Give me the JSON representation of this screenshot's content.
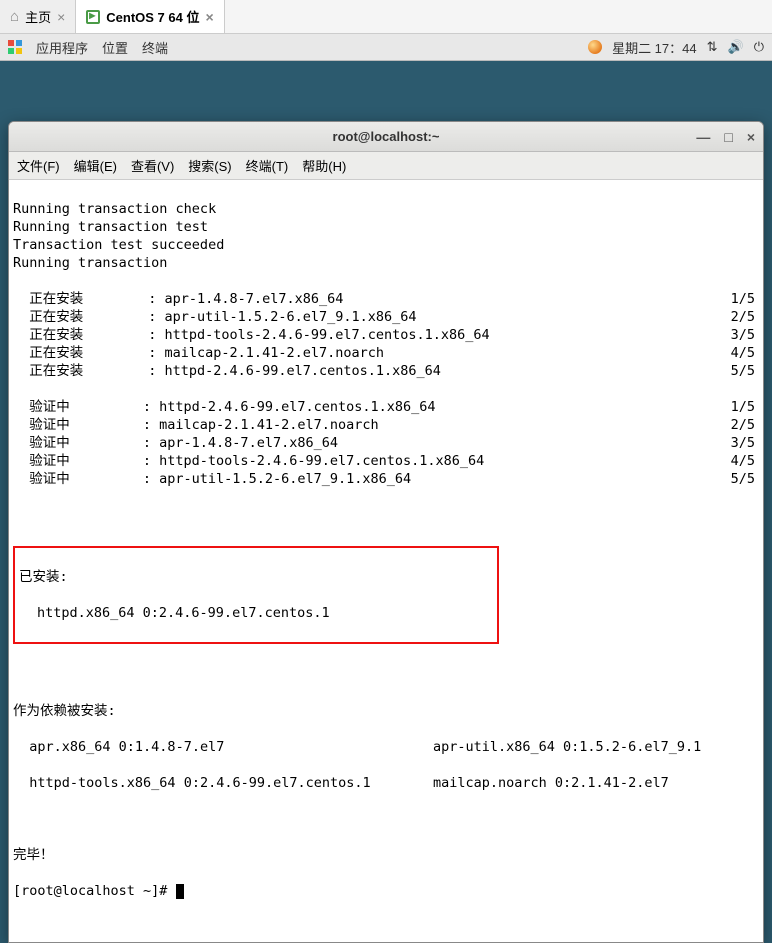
{
  "vmtabs": {
    "home": "主页",
    "centos": "CentOS 7 64 位"
  },
  "topbar": {
    "apps": "应用程序",
    "places": "位置",
    "terminal": "终端",
    "datetime": "星期二 17：44"
  },
  "window": {
    "title": "root@localhost:~"
  },
  "menubar": {
    "file": "文件(F)",
    "edit": "编辑(E)",
    "view": "查看(V)",
    "search": "搜索(S)",
    "terminal": "终端(T)",
    "help": "帮助(H)"
  },
  "output": {
    "pre": [
      "Running transaction check",
      "Running transaction test",
      "Transaction test succeeded",
      "Running transaction"
    ],
    "installing_label": "正在安装",
    "verifying_label": "验证中",
    "install_rows": [
      {
        "pkg": "apr-1.4.8-7.el7.x86_64",
        "n": "1/5"
      },
      {
        "pkg": "apr-util-1.5.2-6.el7_9.1.x86_64",
        "n": "2/5"
      },
      {
        "pkg": "httpd-tools-2.4.6-99.el7.centos.1.x86_64",
        "n": "3/5"
      },
      {
        "pkg": "mailcap-2.1.41-2.el7.noarch",
        "n": "4/5"
      },
      {
        "pkg": "httpd-2.4.6-99.el7.centos.1.x86_64",
        "n": "5/5"
      }
    ],
    "verify_rows": [
      {
        "pkg": "httpd-2.4.6-99.el7.centos.1.x86_64",
        "n": "1/5"
      },
      {
        "pkg": "mailcap-2.1.41-2.el7.noarch",
        "n": "2/5"
      },
      {
        "pkg": "apr-1.4.8-7.el7.x86_64",
        "n": "3/5"
      },
      {
        "pkg": "httpd-tools-2.4.6-99.el7.centos.1.x86_64",
        "n": "4/5"
      },
      {
        "pkg": "apr-util-1.5.2-6.el7_9.1.x86_64",
        "n": "5/5"
      }
    ],
    "installed_header": "已安装:",
    "installed_pkg": "httpd.x86_64 0:2.4.6-99.el7.centos.1",
    "deps_header": "作为依赖被安装:",
    "deps_line1_a": "apr.x86_64 0:1.4.8-7.el7",
    "deps_line1_b": "apr-util.x86_64 0:1.5.2-6.el7_9.1",
    "deps_line2_a": "httpd-tools.x86_64 0:2.4.6-99.el7.centos.1",
    "deps_line2_b": "mailcap.noarch 0:2.1.41-2.el7",
    "done": "完毕！",
    "prompt": "[root@localhost ~]# "
  }
}
